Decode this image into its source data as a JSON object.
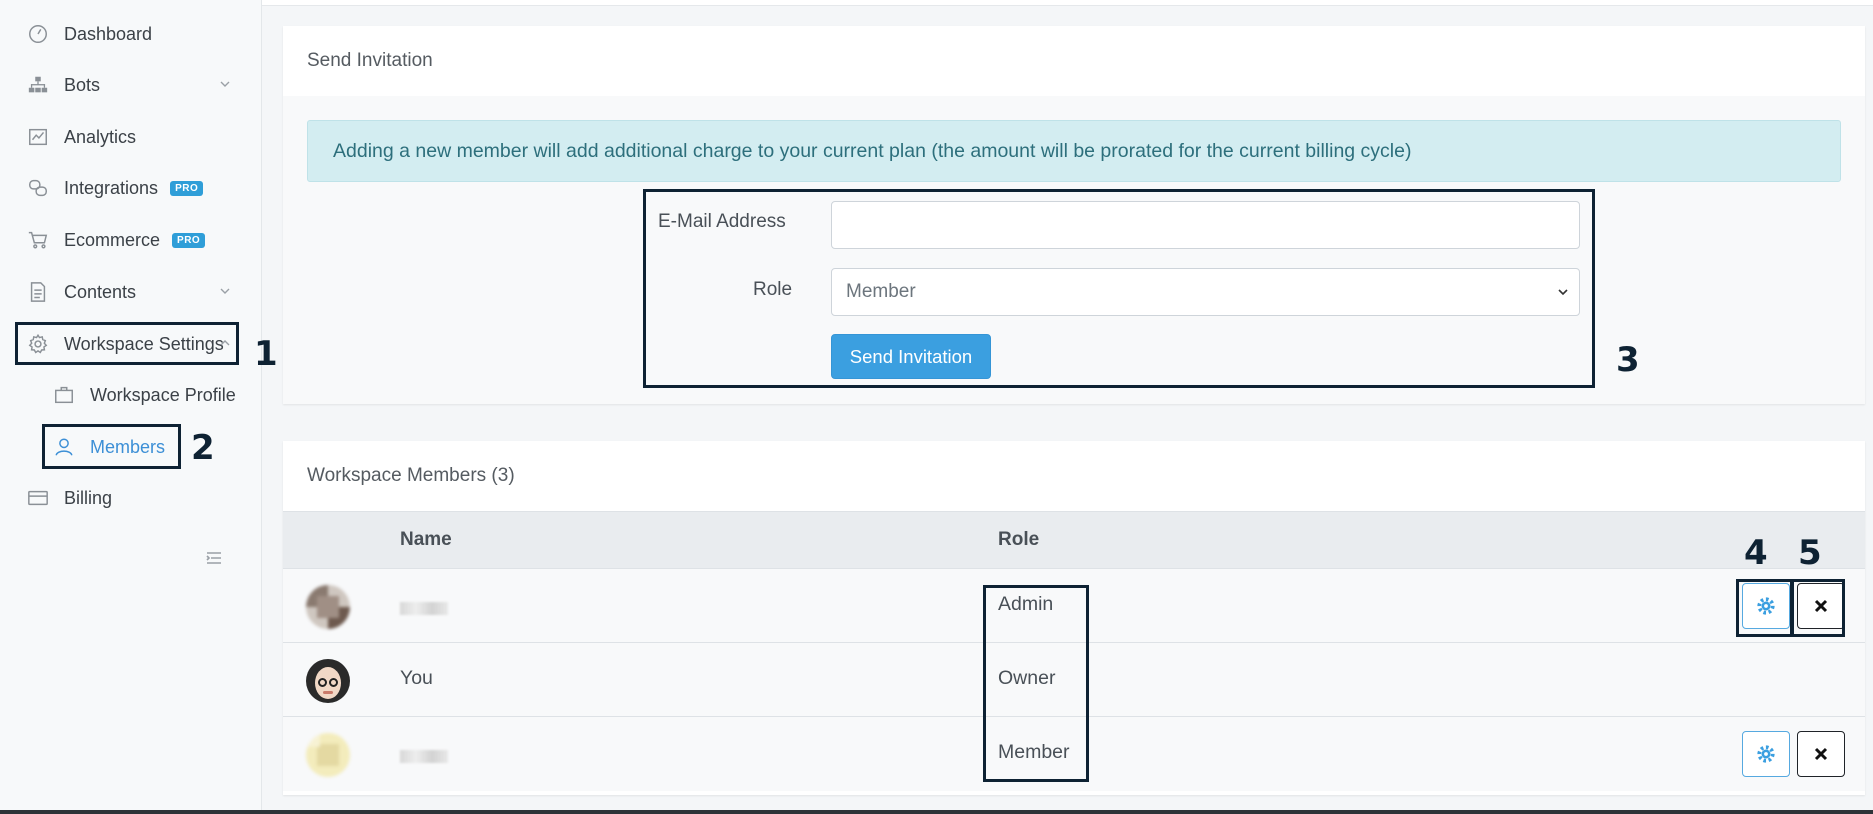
{
  "sidebar": {
    "items": [
      {
        "label": "Dashboard",
        "icon": "dashboard-icon"
      },
      {
        "label": "Bots",
        "icon": "sitemap-icon"
      },
      {
        "label": "Analytics",
        "icon": "analytics-icon"
      },
      {
        "label": "Integrations",
        "icon": "integrations-icon",
        "badge": "PRO"
      },
      {
        "label": "Ecommerce",
        "icon": "cart-icon",
        "badge": "PRO"
      },
      {
        "label": "Contents",
        "icon": "document-icon"
      },
      {
        "label": "Workspace Settings",
        "icon": "gear-icon"
      },
      {
        "label": "Workspace Profile",
        "icon": "briefcase-icon"
      },
      {
        "label": "Members",
        "icon": "user-icon"
      },
      {
        "label": "Billing",
        "icon": "credit-card-icon"
      }
    ]
  },
  "invite": {
    "title": "Send Invitation",
    "alert": "Adding a new member will add additional charge to your current plan (the amount will be prorated for the current billing cycle)",
    "email_label": "E-Mail Address",
    "email_value": "",
    "role_label": "Role",
    "role_value": "Member",
    "submit_label": "Send Invitation"
  },
  "members": {
    "title": "Workspace Members (3)",
    "columns": {
      "name": "Name",
      "role": "Role"
    },
    "rows": [
      {
        "name": "",
        "role": "Admin",
        "actions": true
      },
      {
        "name": "You",
        "role": "Owner",
        "actions": false
      },
      {
        "name": "",
        "role": "Member",
        "actions": true
      }
    ]
  },
  "annotations": [
    "1",
    "2",
    "3",
    "4",
    "5"
  ],
  "colors": {
    "accent": "#3b9fe0",
    "alert_bg": "#d3edf1",
    "annotation": "#0e2233",
    "pro_badge": "#2f9ed8"
  }
}
